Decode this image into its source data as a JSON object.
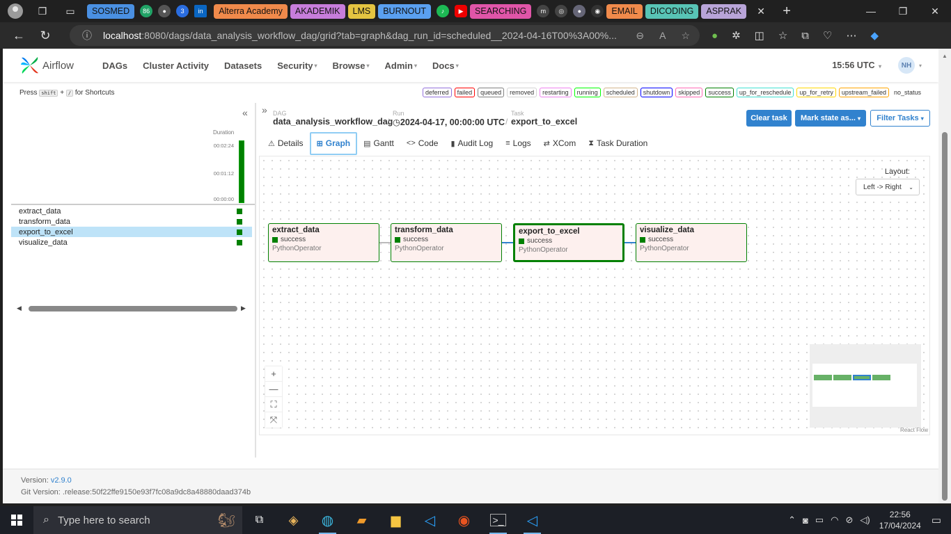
{
  "browser": {
    "bookmarks": [
      {
        "label": "SOSMED",
        "color": "#4a90e2"
      },
      {
        "label": "Alterra Academy",
        "color": "#f08a4b"
      },
      {
        "label": "AKADEMIK",
        "color": "#c77ddb"
      },
      {
        "label": "LMS",
        "color": "#e4c441"
      },
      {
        "label": "BURNOUT",
        "color": "#5aa0f0"
      },
      {
        "label": "SEARCHING",
        "color": "#e055a8"
      },
      {
        "label": "EMAIL",
        "color": "#f08a4b"
      },
      {
        "label": "DICODING",
        "color": "#58c4b5"
      },
      {
        "label": "ASPRAK",
        "color": "#b8a4d8"
      }
    ],
    "badge_count_1": "86",
    "badge_count_2": "3",
    "url_host": "localhost",
    "url_rest": ":8080/dags/data_analysis_workflow_dag/grid?tab=graph&dag_run_id=scheduled__2024-04-16T00%3A00%..."
  },
  "airflow": {
    "logo_text": "Airflow",
    "menu": [
      "DAGs",
      "Cluster Activity",
      "Datasets",
      "Security",
      "Browse",
      "Admin",
      "Docs"
    ],
    "menu_has_caret": [
      false,
      false,
      false,
      true,
      true,
      true,
      true
    ],
    "clock": "15:56 UTC",
    "avatar_initials": "NH",
    "shortcuts_prefix": "Press",
    "shortcuts_key1": "shift",
    "shortcuts_plus": "+",
    "shortcuts_key2": "/",
    "shortcuts_suffix": "for Shortcuts",
    "states": [
      {
        "label": "deferred",
        "color": "#9370db"
      },
      {
        "label": "failed",
        "color": "#ff0000"
      },
      {
        "label": "queued",
        "color": "#808080"
      },
      {
        "label": "removed",
        "color": "#d3d3d3"
      },
      {
        "label": "restarting",
        "color": "#ee82ee"
      },
      {
        "label": "running",
        "color": "#00ff00"
      },
      {
        "label": "scheduled",
        "color": "#d2b48c"
      },
      {
        "label": "shutdown",
        "color": "#0000ff"
      },
      {
        "label": "skipped",
        "color": "#ff69b4"
      },
      {
        "label": "success",
        "color": "#008000"
      },
      {
        "label": "up_for_reschedule",
        "color": "#40e0d0"
      },
      {
        "label": "up_for_retry",
        "color": "#ffd700"
      },
      {
        "label": "upstream_failed",
        "color": "#ffa500"
      },
      {
        "label": "no_status",
        "color": "#ffffff"
      }
    ],
    "grid": {
      "duration_label": "Duration",
      "duration_ticks": [
        "00:02:24",
        "00:01:12",
        "00:00:00"
      ],
      "tasks": [
        "extract_data",
        "transform_data",
        "export_to_excel",
        "visualize_data"
      ],
      "selected_task": "export_to_excel"
    },
    "breadcrumb": {
      "dag_label": "DAG",
      "dag_value": "data_analysis_workflow_dag",
      "run_label": "Run",
      "run_value": "2024-04-17, 00:00:00 UTC",
      "task_label": "Task",
      "task_value": "export_to_excel"
    },
    "buttons": {
      "clear_task": "Clear task",
      "mark_state": "Mark state as...",
      "filter_tasks": "Filter Tasks"
    },
    "tabs": [
      "Details",
      "Graph",
      "Gantt",
      "Code",
      "Audit Log",
      "Logs",
      "XCom",
      "Task Duration"
    ],
    "active_tab": "Graph",
    "graph": {
      "layout_label": "Layout:",
      "layout_value": "Left -> Right",
      "nodes": [
        {
          "name": "extract_data",
          "state": "success",
          "operator": "PythonOperator"
        },
        {
          "name": "transform_data",
          "state": "success",
          "operator": "PythonOperator"
        },
        {
          "name": "export_to_excel",
          "state": "success",
          "operator": "PythonOperator"
        },
        {
          "name": "visualize_data",
          "state": "success",
          "operator": "PythonOperator"
        }
      ],
      "attribution": "React Flow"
    },
    "footer": {
      "version_label": "Version:",
      "version_value": "v2.9.0",
      "git_label": "Git Version:",
      "git_value": ".release:50f22ffe9150e93f7fc08a9dc8a48880daad374b"
    }
  },
  "taskbar": {
    "search_placeholder": "Type here to search",
    "time": "22:56",
    "date": "17/04/2024"
  },
  "colors": {
    "accent": "#3182ce",
    "success": "#008000"
  }
}
